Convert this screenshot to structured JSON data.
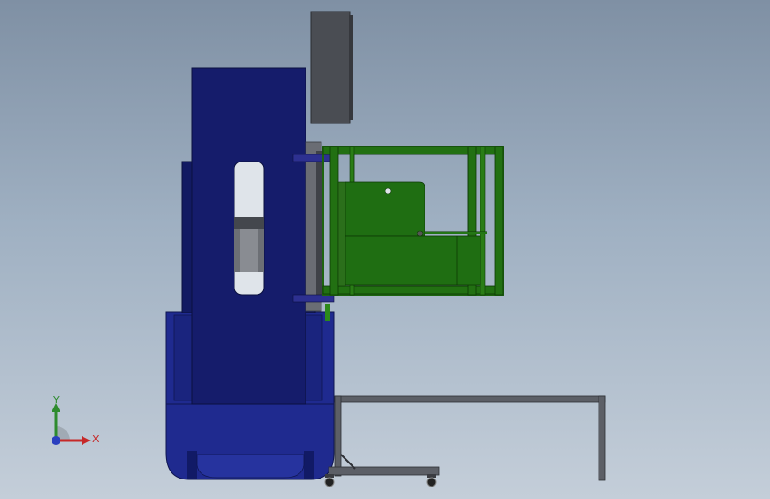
{
  "triad": {
    "x_label": "X",
    "y_label": "Y",
    "x_color": "#c62828",
    "y_color": "#2e8b2e",
    "z_color": "#2a3fbf"
  },
  "colors": {
    "viewport_top": "#7f90a4",
    "viewport_bottom": "#c4ced9",
    "column_blue": "#151c6b",
    "base_blue": "#1f2a8f",
    "module_green": "#1f6e12",
    "frame_green": "#1e6410",
    "steel_gray": "#5c5f66",
    "panel_gray": "#4a4d53"
  }
}
